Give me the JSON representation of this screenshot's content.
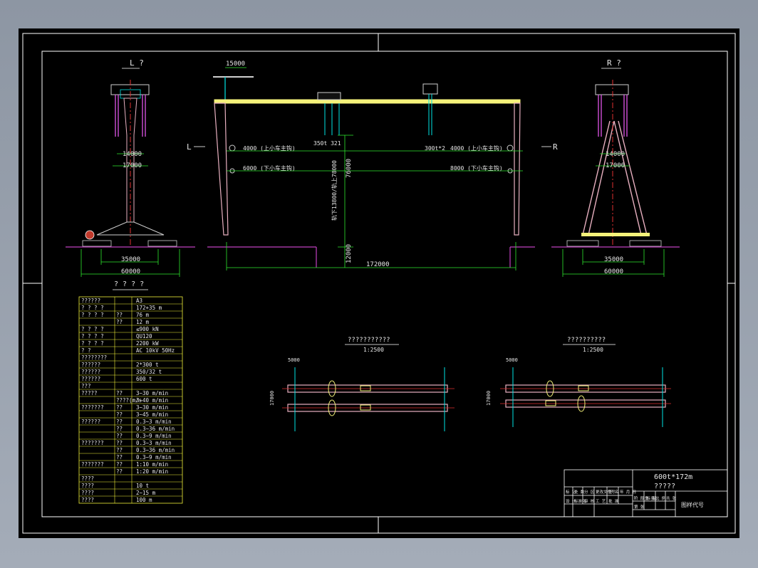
{
  "drawing": {
    "left_view_title": "L ?",
    "right_view_title": "R ?",
    "left_arrow": "L",
    "right_arrow": "R",
    "left_view": {
      "dim_width_inner": "14000",
      "dim_width_outer": "17000",
      "dim_track": "35000",
      "dim_base": "60000"
    },
    "right_view": {
      "dim_width_inner": "14000",
      "dim_width_outer": "17000",
      "dim_track": "35000",
      "dim_base": "60000"
    },
    "elevation": {
      "dim_jib": "15000",
      "dim_span": "172000",
      "dim_height": "76000",
      "dim_under": "12000",
      "vertical_note": "轨下13800/轨上78000",
      "trolley_left": "350t 321",
      "trolley_right": "300t*2",
      "upper_left": "4000 (上小车主钩)",
      "lower_left": "6000 (下小车主钩)",
      "upper_right": "4000 (上小车主钩)",
      "lower_right": "8000 (下小车主钩)"
    },
    "plan_left": {
      "title": "???????????",
      "scale": "1:2500",
      "dim_top": "5000",
      "dim_side": "17000"
    },
    "plan_right": {
      "title": "??????????",
      "scale": "1:2500",
      "dim_top": "5000",
      "dim_side": "17000"
    }
  },
  "params_table": {
    "title": "? ? ? ?",
    "rows": [
      {
        "label": "??????",
        "unit": "",
        "value": "A3"
      },
      {
        "label": "? ? ? ?",
        "unit": "",
        "value": "172+35  m"
      },
      {
        "label": "? ?  ? ?",
        "unit": "??",
        "value": "76  m"
      },
      {
        "label": "",
        "unit": "??",
        "value": "12  m"
      },
      {
        "label": "? ? ? ?",
        "unit": "",
        "value": "≤900 kN"
      },
      {
        "label": "? ?  ? ?",
        "unit": "",
        "value": "QU120"
      },
      {
        "label": "? ? ? ?",
        "unit": "",
        "value": "2200 kW"
      },
      {
        "label": "?      ?",
        "unit": "",
        "value": "AC  10kV  50Hz"
      },
      {
        "label": "????????",
        "unit": "",
        "value": ""
      },
      {
        "label": "??????",
        "unit": "",
        "value": "2*300  t"
      },
      {
        "label": "??????",
        "unit": "",
        "value": "350/32 t"
      },
      {
        "label": "??????",
        "unit": "",
        "value": "600  t"
      },
      {
        "label": "???",
        "unit": "",
        "value": ""
      },
      {
        "label": "?????",
        "unit": "??",
        "value": "3~30  m/min"
      },
      {
        "label": "",
        "unit": "????(m/s",
        "value": "3~40  m/min"
      },
      {
        "label": "???????",
        "unit": "??",
        "value": "3~30  m/min"
      },
      {
        "label": "",
        "unit": "??",
        "value": "3~45  m/min"
      },
      {
        "label": "??????",
        "unit": "??",
        "value": "0.3~3  m/min"
      },
      {
        "label": "",
        "unit": "??",
        "value": "0.3~36  m/min"
      },
      {
        "label": "",
        "unit": "??",
        "value": "0.3~9  m/min"
      },
      {
        "label": "???????",
        "unit": "??",
        "value": "0.3~3  m/min"
      },
      {
        "label": "",
        "unit": "??",
        "value": "0.3~36  m/min"
      },
      {
        "label": "",
        "unit": "??",
        "value": "0.3~9  m/min"
      },
      {
        "label": "???????",
        "unit": "??",
        "value": "1:10  m/min"
      },
      {
        "label": "",
        "unit": "??",
        "value": "1:20  m/min"
      },
      {
        "label": "????",
        "unit": "",
        "value": ""
      },
      {
        "label": "????",
        "unit": "",
        "value": "10  t"
      },
      {
        "label": "????",
        "unit": "",
        "value": "2~15  m"
      },
      {
        "label": "????",
        "unit": "",
        "value": "100  m"
      }
    ]
  },
  "title_block": {
    "title_line1": "600t*172m",
    "title_line2": "?????",
    "drawing_code": "图样代号",
    "cells": [
      "标 记",
      "处 数",
      "分 区",
      "更改文件号",
      "签 名",
      "年 月 日",
      "设 计",
      "标准化",
      "审 核",
      "工 艺",
      "批 准",
      "阶 段 标 记",
      "重 量",
      "比 例",
      "共 张",
      "第 张"
    ]
  },
  "colors": {
    "background": "#000000",
    "frame": "#ffffff",
    "girder": "#f5f27a",
    "dimension": "#2ee82e",
    "leg": "#e8b0c0",
    "hoist": "#d04fd8",
    "centerline": "#e03030",
    "ground": "#c040c0",
    "table_border": "#f2f23a",
    "rail": "#00e5e5"
  }
}
